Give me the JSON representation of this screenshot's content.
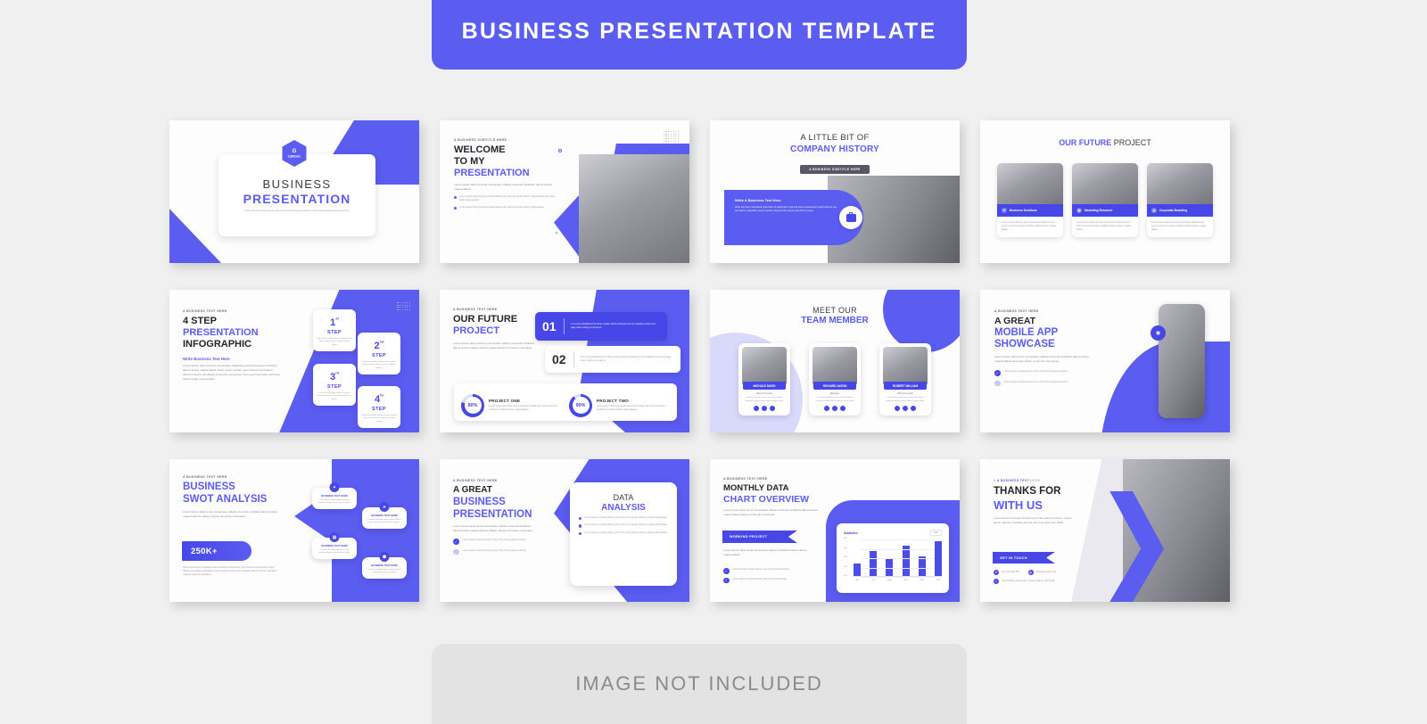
{
  "header": {
    "title": "BUSINESS PRESENTATION TEMPLATE"
  },
  "footer": {
    "title": "IMAGE NOT INCLUDED"
  },
  "colors": {
    "accent": "#5b5cf0",
    "accent_dark": "#4747e8",
    "dark_text": "#24242e",
    "page_bg": "#f0f0f0",
    "slide_bg": "#fdfdfd"
  },
  "logo": {
    "mark": "G",
    "name": "COMPANY",
    "tagline": "slogan goes here"
  },
  "slides": [
    {
      "id": "title-slide",
      "title_line1": "BUSINESS",
      "title_line2": "PRESENTATION",
      "body": "Lorem Ipsum is simply dummy text of the print and typeset industry. Lorem has standard dummy text ever."
    },
    {
      "id": "welcome-slide",
      "eyebrow": "A BUSINESS SUBTITLE HERE",
      "title_line1": "WELCOME",
      "title_line2": "TO MY",
      "title_line3": "PRESENTATION",
      "body": "Lorem ipsum dolor sit amet consectetur adipisc eiusmod incididunt labore dolore magna aliqua.",
      "bullets": [
        "Lorem ipsum dolor sit amet consect adipisc elit, eiusmod tempor dolore magna aliqua. Duis aute fugiat nulla pariatur.",
        "Lorem ipsum dolor sit amet consect adipisc elit, eiusmod tempor dolore magna aliqua."
      ]
    },
    {
      "id": "company-history-slide",
      "title_line1": "A LITTLE BIT OF",
      "title_line2": "COMPANY HISTORY",
      "pill": "A BUSINESS SUBTITLE HERE",
      "card_title": "Write A Business Text Here",
      "card_body": "Write and open voluptatem quia dolor sit aspernatur fugit sed quia consequuntur magni dolores eos qui ratione voluptatem sequi nesciunt. Neque dolor ipsum quia dolor sit amet."
    },
    {
      "id": "future-project-slide",
      "title_blue": "OUR FUTURE",
      "title_dark": "PROJECT",
      "cards": [
        {
          "label": "Business Solutions",
          "icon": "gear-icon",
          "body": "Lorem ipsum dolor sit amet consectetur adipiscing elit sed do eiusmod tempor incididunt labore dolore magna aliqua."
        },
        {
          "label": "Marketing Research",
          "icon": "globe-icon",
          "body": "Lorem ipsum dolor sit amet consectetur adipiscing elit sed do eiusmod tempor incididunt labore dolore magna aliqua."
        },
        {
          "label": "Corporate Branding",
          "icon": "target-icon",
          "body": "Lorem ipsum dolor sit amet consectetur adipiscing elit sed do eiusmod tempor incididunt labore dolore magna aliqua."
        }
      ]
    },
    {
      "id": "four-step-infographic-slide",
      "eyebrow": "A BUSINESS TEXT HERE",
      "title_line1": "4 STEP",
      "title_line2": "PRESENTATION",
      "title_line3": "INFOGRAPHIC",
      "subtitle": "Write Business Text Here",
      "body": "Lorem ipsum dolor sit amet consectetur adipiscing eiusmod tempor incididunt labore dolore magna aliqua. Enim minim veniam quis nostrud exercitation ullamco laboris nisi aliquip commodo consequat. Duis aute irure dolor velit esse dolore fugiat nulla pariatur.",
      "steps": [
        {
          "num": "1",
          "sup": "st",
          "word": "STEP",
          "body": "Sed ante eiusmod tempor incididunt labore dolore magna aliqua et dolore magna aliqua."
        },
        {
          "num": "2",
          "sup": "nd",
          "word": "STEP",
          "body": "Consecte incididunt labore dolore magna aliqua sit amet consec tempor incididunt labore."
        },
        {
          "num": "3",
          "sup": "rd",
          "word": "STEP",
          "body": "Duis aute irure dolor adipiscit sit amet incididunt labore sit amet consec dolore et labore."
        },
        {
          "num": "4",
          "sup": "th",
          "word": "STEP",
          "body": "Sed enim incididunt labore sit amet tempor dolore sit amet consec dolore et labore pariatur."
        }
      ]
    },
    {
      "id": "our-future-project-slide",
      "eyebrow": "A BUSINESS TEXT HERE",
      "title_line1": "OUR FUTURE",
      "title_line2": "PROJECT",
      "body": "Lorem ipsum dolor sit amet consectetur adipisc eiusmod incididunt labore dolore magna ullamco aliqua aliqua commodo consequat.",
      "numbered": [
        {
          "num": "01",
          "body": "It is a long established fact that a reader will be distracted by the readable content of a page when looking at its layout."
        },
        {
          "num": "02",
          "body": "It is a long established fact that a reader will be distracted by the readable content of a page when looking at its layout."
        }
      ],
      "projects": [
        {
          "percent": "80%",
          "name": "PROJECT ONE",
          "body": "Lorem ipsum dolor ipsa amet consectetur adipisc elit eiusmod tempor incididunt ut labore dolore magna aliqua."
        },
        {
          "percent": "90%",
          "name": "PROJECT TWO",
          "body": "Lorem ipsum dolor ipsa amet consectetur adipisc elit eiusmod tempor incididunt ut labore dolore magna aliqua."
        }
      ]
    },
    {
      "id": "team-member-slide",
      "title_dark": "MEET OUR",
      "title_blue": "TEAM MEMBER",
      "members": [
        {
          "name": "MICHALE DAVID",
          "role": "CEO & Founder",
          "body": "Lorem ipsum dolor amet consectetur adipisc eiusmod incididunt labore dolore magna aliqua."
        },
        {
          "name": "RICHARD JASON",
          "role": "Manager",
          "body": "Lorem ipsum dolor amet consectetur adipisc eiusmod incididunt labore dolore magna aliqua."
        },
        {
          "name": "ROBERT WILLIAM",
          "role": "CEO & Founder",
          "body": "Lorem ipsum dolor amet consectetur adipisc eiusmod incididunt labore dolore magna aliqua."
        }
      ]
    },
    {
      "id": "mobile-app-slide",
      "eyebrow": "A BUSINESS TEXT HERE",
      "title_line1": "A GREAT",
      "title_line2": "MOBILE APP",
      "title_line3": "SHOWCASE",
      "body": "Lorem ipsum dolor amet consectetur adipisc eiusmod incididunt labore dolore magna aliqua elit neque aliqua commodo consequat.",
      "checks": [
        "Lorem ipsum is simply dummy text of the print & typeset industry.",
        "Lorem ipsum is simply dummy text of the print & typeset industry."
      ]
    },
    {
      "id": "swot-analysis-slide",
      "eyebrow": "A BUSINESS TEXT HERE",
      "title_line1": "BUSINESS",
      "title_line2": "SWOT ANALYSIS",
      "body": "Lorem ipsum dolor amet consectetur adipisc eiusmod incididunt labore dolore magna ullamco aliqua. Aliqua commodo consequat.",
      "stat": "250K+",
      "stat_body": "Nemo enim ipsam voluptatem quia voluptas sit aspernatur fugit sedquia consequuntur magni dolores eos ratione voluptatem sequi nesciunt neque porro quisquam dolorem ipsum quia dolor magnam quaerat voluptatem.",
      "cards": [
        {
          "label": "BUSINESS TEXT HERE",
          "icon": "gear-icon",
          "body": "Duis aute irure dolor adipiscit sit amet incididunt labore sit amet consec dolore."
        },
        {
          "label": "BUSINESS TEXT HERE",
          "icon": "rocket-icon",
          "body": "Consecte incididunt labore sit amet dolor sit amet adipiscing labore dolore pariatur."
        },
        {
          "label": "BUSINESS TEXT HERE",
          "icon": "chart-icon",
          "body": "Duis aute irure dolor adipiscit sit amet incididunt labore sit amet consec dolore."
        },
        {
          "label": "BUSINESS TEXT HERE",
          "icon": "shield-icon",
          "body": "Consecte incididunt labore sit amet dolor sit amet adipiscing labore dolore."
        }
      ]
    },
    {
      "id": "data-analysis-slide",
      "eyebrow": "A BUSINESS TEXT HERE",
      "title_line1": "A GREAT",
      "title_line2": "BUSINESS",
      "title_line3": "PRESENTATION",
      "body": "Lorem ipsum dolor amet consectetur adipisc eiusmod incididunt labore dolore magna ullamco aliqua. Aliqua commodo consequat.",
      "checks": [
        "Lorem ipsum is simply dummy text of the print & typeset industry.",
        "Lorem ipsum is simply dummy text of the print & typeset industry."
      ],
      "card_title_dark": "DATA",
      "card_title_blue": "ANALYSIS",
      "card_bullets": [
        "Lorem ipsum is simply dummy text of the print typeset industry. Fugiat nulla pariatur.",
        "Lorem ipsum is simply dummy text of the print typeset industry. Fugiat nulla pariatur.",
        "Lorem ipsum is simply dummy text of the print typeset industry. Fugiat nulla pariatur."
      ]
    },
    {
      "id": "chart-overview-slide",
      "eyebrow": "A BUSINESS TEXT HERE",
      "title_line1": "MONTHLY DATA",
      "title_line2": "CHART OVERVIEW",
      "body": "Lorem ipsum dolor amet consectetur adipisc eiusmod incididunt labore dolore magna aliqua aliqua commodo consequat.",
      "ribbon": "WORKING PROJECT",
      "ribbon_body": "Lorem ipsum dolor amet consectetur adipisc incididunt labore dolore magna aliqua.",
      "checks": [
        "Lorem ipsum is simply dummy text of the typeset industry.",
        "Lorem ipsum is simply dummy text of the print industry."
      ]
    },
    {
      "id": "thanks-slide",
      "eyebrow_blue": "A BUSINESS TEXT",
      "eyebrow_gray": "HERE",
      "title_line1": "THANKS FOR",
      "title_line2": "WITH US",
      "body": "Lorem ipsum is simply dummy text of the print & industry. Lorem ipsum industry standard dummy text ever since the 1500.",
      "ribbon": "GET IN TOUCH",
      "contacts": [
        {
          "icon": "phone-icon",
          "text": "+01 123 456 789"
        },
        {
          "icon": "globe-icon",
          "text": "Website Goes Here"
        },
        {
          "icon": "location-icon",
          "text": "Your Address Goes Here, Country Name, AB 12345"
        }
      ]
    }
  ],
  "chart_data": {
    "type": "bar",
    "title": "Statistics",
    "legend": "2023",
    "categories": [
      "JAN",
      "FEB",
      "MAR",
      "APR",
      "MAY",
      "JUN"
    ],
    "values": [
      200,
      400,
      280,
      480,
      320,
      560
    ],
    "ylabels": [
      "600",
      "500",
      "400",
      "300",
      "200"
    ],
    "ylim": [
      0,
      600
    ],
    "xlabel": "",
    "ylabel": "",
    "grid": true,
    "legend_position": "top-right"
  }
}
